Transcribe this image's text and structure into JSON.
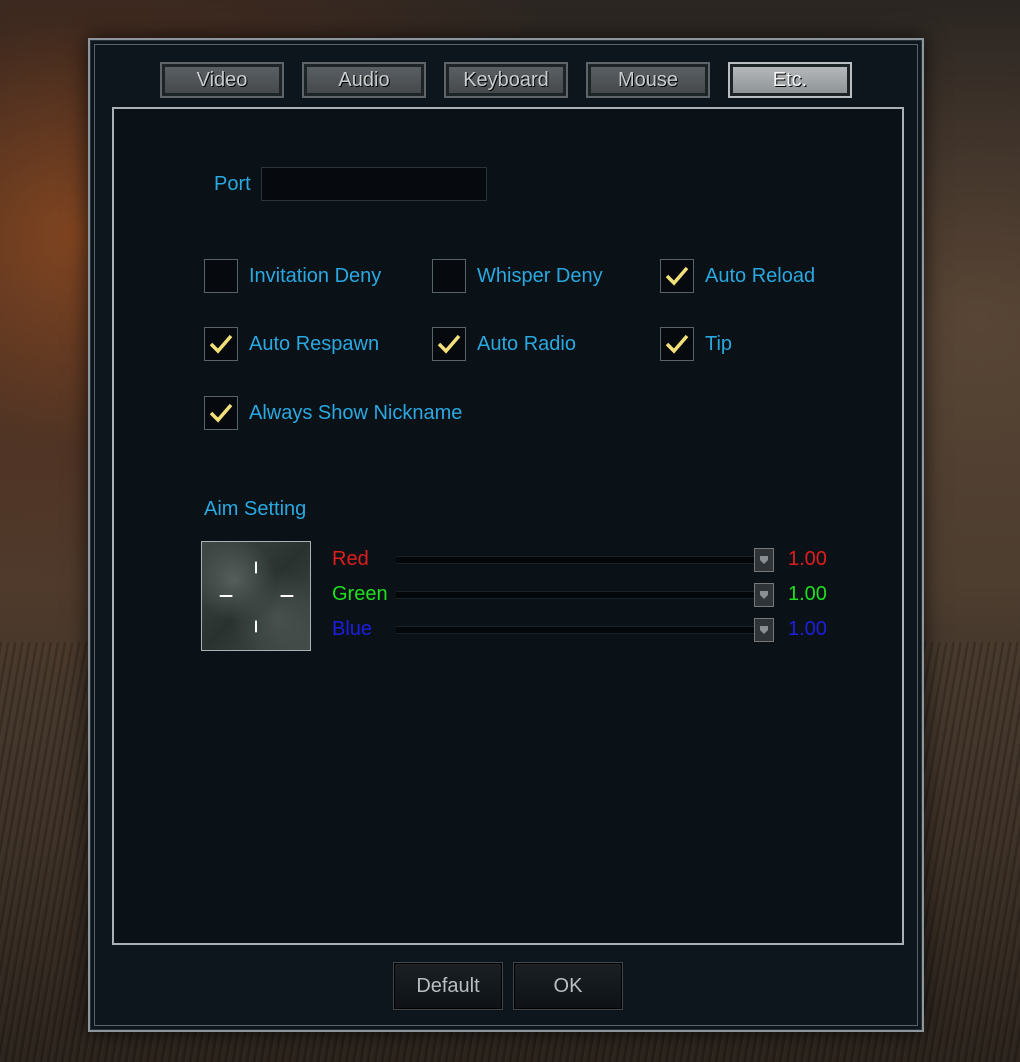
{
  "tabs": [
    {
      "label": "Video",
      "active": false
    },
    {
      "label": "Audio",
      "active": false
    },
    {
      "label": "Keyboard",
      "active": false
    },
    {
      "label": "Mouse",
      "active": false
    },
    {
      "label": "Etc.",
      "active": true
    }
  ],
  "port": {
    "label": "Port",
    "value": ""
  },
  "options": [
    {
      "label": "Invitation Deny",
      "checked": false
    },
    {
      "label": "Whisper Deny",
      "checked": false
    },
    {
      "label": "Auto Reload",
      "checked": true
    },
    {
      "label": "Auto Respawn",
      "checked": true
    },
    {
      "label": "Auto Radio",
      "checked": true
    },
    {
      "label": "Tip",
      "checked": true
    },
    {
      "label": "Always Show Nickname",
      "checked": true
    }
  ],
  "aim": {
    "title": "Aim Setting",
    "sliders": [
      {
        "label": "Red",
        "value": "1.00",
        "color": "#e01e1e"
      },
      {
        "label": "Green",
        "value": "1.00",
        "color": "#1ee01e"
      },
      {
        "label": "Blue",
        "value": "1.00",
        "color": "#1e1ee0"
      }
    ]
  },
  "buttons": {
    "default_label": "Default",
    "ok_label": "OK"
  },
  "colors": {
    "label_blue": "#2aa8e0",
    "check_yellow": "#f3e07a"
  }
}
